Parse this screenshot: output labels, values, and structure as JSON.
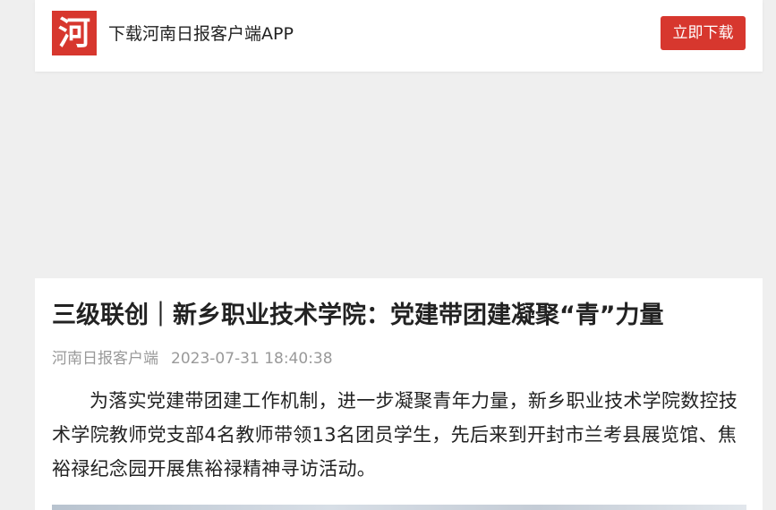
{
  "banner": {
    "logo_char": "河",
    "text": "下载河南日报客户端APP",
    "button_label": "立即下载",
    "accent_color": "#d7372e"
  },
  "article": {
    "title": "三级联创｜新乡职业技术学院：党建带团建凝聚“青”力量",
    "source": "河南日报客户端",
    "datetime": "2023-07-31 18:40:38",
    "paragraph": "为落实党建带团建工作机制，进一步凝聚青年力量，新乡职业技术学院数控技术学院教师党支部4名教师带领13名团员学生，先后来到开封市兰考县展览馆、焦裕禄纪念园开展焦裕禄精神寻访活动。"
  }
}
